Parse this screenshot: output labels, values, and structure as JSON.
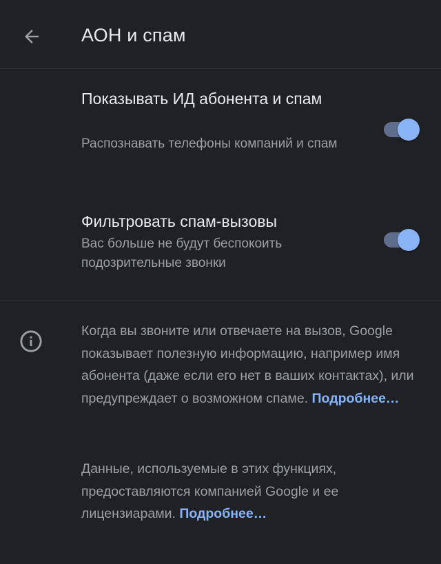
{
  "header": {
    "title": "АОН и спам",
    "back_icon": "arrow-back-icon"
  },
  "settings": [
    {
      "title": "Показывать ИД абонента и спам",
      "subtitle": "Распознавать телефоны компаний и спам",
      "enabled": true
    },
    {
      "title": "Фильтровать спам-вызовы",
      "subtitle": "Вас больше не будут беспокоить подозрительные звонки",
      "enabled": true
    }
  ],
  "info": {
    "icon": "info-icon",
    "paragraph1_text": "Когда вы звоните или отвечаете на вызов, Google показывает полезную информацию, например имя абонента (даже если его нет в ваших контактах), или предупреждает о возможном спаме. ",
    "paragraph1_link": "Подробнее…",
    "paragraph2_text": "Данные, используемые в этих функциях, предоставляются компанией Google и ее лицензиарами. ",
    "paragraph2_link": "Подробнее…"
  },
  "colors": {
    "background": "#202124",
    "text_primary": "#e8eaed",
    "text_secondary": "#9aa0a6",
    "accent": "#8ab4f8",
    "toggle_track": "#5f6e8c"
  }
}
